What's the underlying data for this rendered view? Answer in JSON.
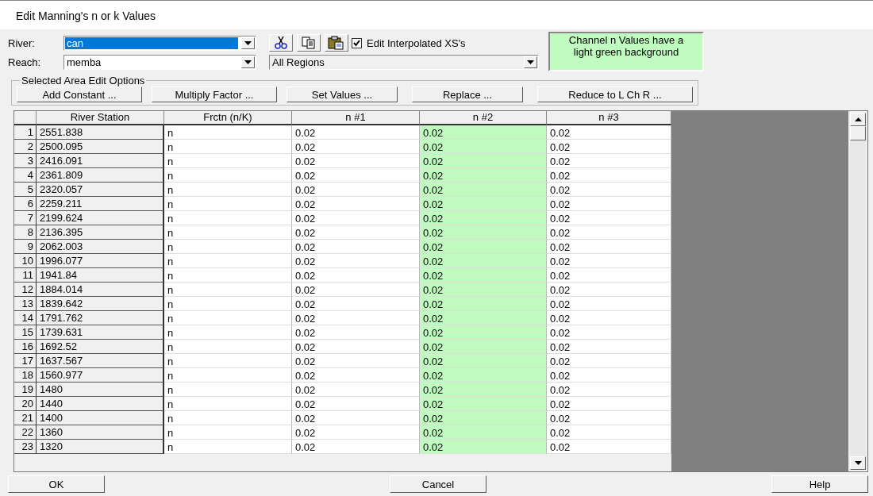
{
  "window": {
    "title": "Edit Manning's n or k Values"
  },
  "river": {
    "label": "River:",
    "value": "can",
    "text_selected": true
  },
  "reach": {
    "label": "Reach:",
    "value": "memba"
  },
  "edit_interpolated": {
    "label": "Edit Interpolated XS's",
    "checked": true
  },
  "regions": {
    "value": "All Regions"
  },
  "note": "Channel n Values have a light green background",
  "edit_options": {
    "title": "Selected Area Edit Options",
    "buttons": [
      "Add Constant ...",
      "Multiply Factor ...",
      "Set Values ...",
      "Replace ...",
      "Reduce to L Ch R ..."
    ]
  },
  "table": {
    "columns": [
      {
        "label": "River Station",
        "channel": false
      },
      {
        "label": "Frctn (n/K)",
        "channel": false
      },
      {
        "label": "n #1",
        "channel": false
      },
      {
        "label": "n #2",
        "channel": true
      },
      {
        "label": "n #3",
        "channel": false
      }
    ],
    "rows": [
      {
        "number": "1",
        "cells": [
          "2551.838",
          "n",
          "0.02",
          "0.02",
          "0.02"
        ]
      },
      {
        "number": "2",
        "cells": [
          "2500.095",
          "n",
          "0.02",
          "0.02",
          "0.02"
        ]
      },
      {
        "number": "3",
        "cells": [
          "2416.091",
          "n",
          "0.02",
          "0.02",
          "0.02"
        ]
      },
      {
        "number": "4",
        "cells": [
          "2361.809",
          "n",
          "0.02",
          "0.02",
          "0.02"
        ]
      },
      {
        "number": "5",
        "cells": [
          "2320.057",
          "n",
          "0.02",
          "0.02",
          "0.02"
        ]
      },
      {
        "number": "6",
        "cells": [
          "2259.211",
          "n",
          "0.02",
          "0.02",
          "0.02"
        ]
      },
      {
        "number": "7",
        "cells": [
          "2199.624",
          "n",
          "0.02",
          "0.02",
          "0.02"
        ]
      },
      {
        "number": "8",
        "cells": [
          "2136.395",
          "n",
          "0.02",
          "0.02",
          "0.02"
        ]
      },
      {
        "number": "9",
        "cells": [
          "2062.003",
          "n",
          "0.02",
          "0.02",
          "0.02"
        ]
      },
      {
        "number": "10",
        "cells": [
          "1996.077",
          "n",
          "0.02",
          "0.02",
          "0.02"
        ]
      },
      {
        "number": "11",
        "cells": [
          "1941.84",
          "n",
          "0.02",
          "0.02",
          "0.02"
        ]
      },
      {
        "number": "12",
        "cells": [
          "1884.014",
          "n",
          "0.02",
          "0.02",
          "0.02"
        ]
      },
      {
        "number": "13",
        "cells": [
          "1839.642",
          "n",
          "0.02",
          "0.02",
          "0.02"
        ]
      },
      {
        "number": "14",
        "cells": [
          "1791.762",
          "n",
          "0.02",
          "0.02",
          "0.02"
        ]
      },
      {
        "number": "15",
        "cells": [
          "1739.631",
          "n",
          "0.02",
          "0.02",
          "0.02"
        ]
      },
      {
        "number": "16",
        "cells": [
          "1692.52",
          "n",
          "0.02",
          "0.02",
          "0.02"
        ]
      },
      {
        "number": "17",
        "cells": [
          "1637.567",
          "n",
          "0.02",
          "0.02",
          "0.02"
        ]
      },
      {
        "number": "18",
        "cells": [
          "1560.977",
          "n",
          "0.02",
          "0.02",
          "0.02"
        ]
      },
      {
        "number": "19",
        "cells": [
          "1480",
          "n",
          "0.02",
          "0.02",
          "0.02"
        ]
      },
      {
        "number": "20",
        "cells": [
          "1440",
          "n",
          "0.02",
          "0.02",
          "0.02"
        ]
      },
      {
        "number": "21",
        "cells": [
          "1400",
          "n",
          "0.02",
          "0.02",
          "0.02"
        ]
      },
      {
        "number": "22",
        "cells": [
          "1360",
          "n",
          "0.02",
          "0.02",
          "0.02"
        ]
      },
      {
        "number": "23",
        "cells": [
          "1320",
          "n",
          "0.02",
          "0.02",
          "0.02"
        ]
      }
    ]
  },
  "buttons": [
    "OK",
    "Cancel",
    "Help"
  ]
}
